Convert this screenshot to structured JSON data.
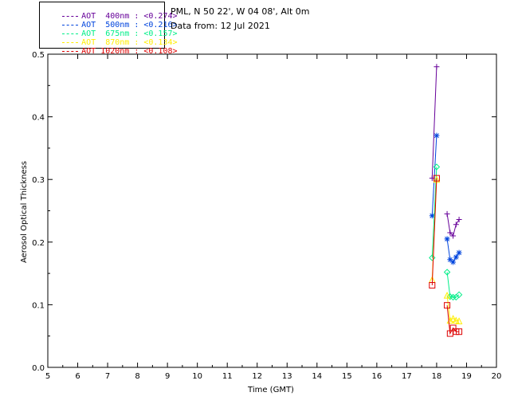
{
  "header": {
    "location": "PML, N 50 22', W 04 08', Alt 0m",
    "date": "Data from: 12 Jul 2021"
  },
  "legend": [
    {
      "label": "AOT  400nm : <0.274>",
      "color": "#660099"
    },
    {
      "label": "AOT  500nm : <0.216>",
      "color": "#0044dd"
    },
    {
      "label": "AOT  675nm : <0.157>",
      "color": "#00ee88"
    },
    {
      "label": "AOT  870nm : <0.134>",
      "color": "#ffee00"
    },
    {
      "label": "AOT 1020nm : <0.108>",
      "color": "#dd0000"
    }
  ],
  "chart_data": {
    "type": "line",
    "xlabel": "Time (GMT)",
    "ylabel": "Aerosol Optical Thickness",
    "xlim": [
      5,
      20
    ],
    "ylim": [
      0,
      0.5
    ],
    "xticks": [
      "5",
      "6",
      "7",
      "8",
      "9",
      "10",
      "11",
      "12",
      "13",
      "14",
      "15",
      "16",
      "17",
      "18",
      "19",
      "20"
    ],
    "yticks": [
      "0.0",
      "0.1",
      "0.2",
      "0.3",
      "0.4",
      "0.5"
    ],
    "series": [
      {
        "name": "AOT  400nm : <0.274>",
        "color": "#660099",
        "marker": "plus",
        "segments": [
          [
            [
              17.85,
              0.302
            ],
            [
              18.0,
              0.48
            ]
          ],
          [
            [
              18.35,
              0.245
            ],
            [
              18.45,
              0.215
            ],
            [
              18.55,
              0.21
            ],
            [
              18.65,
              0.228
            ],
            [
              18.75,
              0.236
            ]
          ]
        ]
      },
      {
        "name": "AOT  500nm : <0.216>",
        "color": "#0044dd",
        "marker": "asterisk",
        "segments": [
          [
            [
              17.85,
              0.242
            ],
            [
              18.0,
              0.37
            ]
          ],
          [
            [
              18.35,
              0.205
            ],
            [
              18.45,
              0.172
            ],
            [
              18.55,
              0.168
            ],
            [
              18.65,
              0.176
            ],
            [
              18.75,
              0.183
            ]
          ]
        ]
      },
      {
        "name": "AOT  675nm : <0.157>",
        "color": "#00ee88",
        "marker": "diamond",
        "segments": [
          [
            [
              17.85,
              0.175
            ],
            [
              18.0,
              0.32
            ]
          ],
          [
            [
              18.35,
              0.152
            ],
            [
              18.45,
              0.113
            ],
            [
              18.55,
              0.112
            ],
            [
              18.65,
              0.112
            ],
            [
              18.75,
              0.116
            ]
          ]
        ]
      },
      {
        "name": "AOT  870nm : <0.134>",
        "color": "#ffee00",
        "marker": "triangle",
        "segments": [
          [
            [
              17.85,
              0.14
            ],
            [
              18.0,
              0.3
            ]
          ],
          [
            [
              18.35,
              0.115
            ],
            [
              18.45,
              0.075
            ],
            [
              18.55,
              0.078
            ],
            [
              18.65,
              0.075
            ],
            [
              18.75,
              0.074
            ]
          ]
        ]
      },
      {
        "name": "AOT 1020nm : <0.108>",
        "color": "#dd0000",
        "marker": "square",
        "segments": [
          [
            [
              17.85,
              0.131
            ],
            [
              18.0,
              0.302
            ]
          ],
          [
            [
              18.35,
              0.099
            ],
            [
              18.45,
              0.054
            ],
            [
              18.55,
              0.063
            ],
            [
              18.65,
              0.057
            ],
            [
              18.75,
              0.057
            ]
          ]
        ]
      }
    ]
  }
}
